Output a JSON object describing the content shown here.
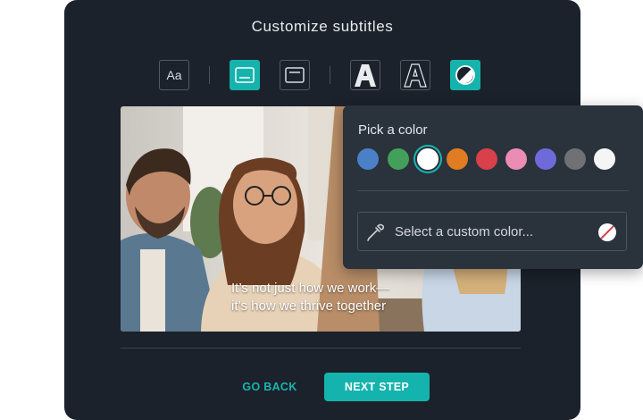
{
  "dialog": {
    "title": "Customize subtitles"
  },
  "toolbar": {
    "buttons": [
      {
        "name": "font-button",
        "label": "Aa",
        "icon": "font-icon",
        "selected": false
      },
      {
        "name": "bottom-position-button",
        "icon": "subtitle-bottom-icon",
        "selected": true
      },
      {
        "name": "top-position-button",
        "icon": "subtitle-top-icon",
        "selected": false
      },
      {
        "name": "filled-text-style-button",
        "icon": "filled-letter-a-icon",
        "selected": false
      },
      {
        "name": "outline-text-style-button",
        "icon": "outline-letter-a-icon",
        "selected": false
      },
      {
        "name": "color-button",
        "icon": "color-contrast-icon",
        "selected": true
      }
    ]
  },
  "preview": {
    "caption_line1": "It’s not just how we work—",
    "caption_line2": "it’s how we thrive together"
  },
  "footer": {
    "back_label": "GO BACK",
    "next_label": "NEXT STEP"
  },
  "color_picker": {
    "title": "Pick a color",
    "swatches": [
      {
        "color": "#4a80c8",
        "selected": false
      },
      {
        "color": "#43a05a",
        "selected": false
      },
      {
        "color": "#ffffff",
        "selected": true
      },
      {
        "color": "#e07c22",
        "selected": false
      },
      {
        "color": "#d8404a",
        "selected": false
      },
      {
        "color": "#ea8cb4",
        "selected": false
      },
      {
        "color": "#6f6ad9",
        "selected": false
      },
      {
        "color": "#6f7174",
        "selected": false
      },
      {
        "color": "#f5f5f5",
        "selected": false
      }
    ],
    "custom_label": "Select a custom color..."
  },
  "colors": {
    "accent": "#16b3ad",
    "panel_bg": "#1b222b",
    "popup_bg": "#2a323c"
  }
}
